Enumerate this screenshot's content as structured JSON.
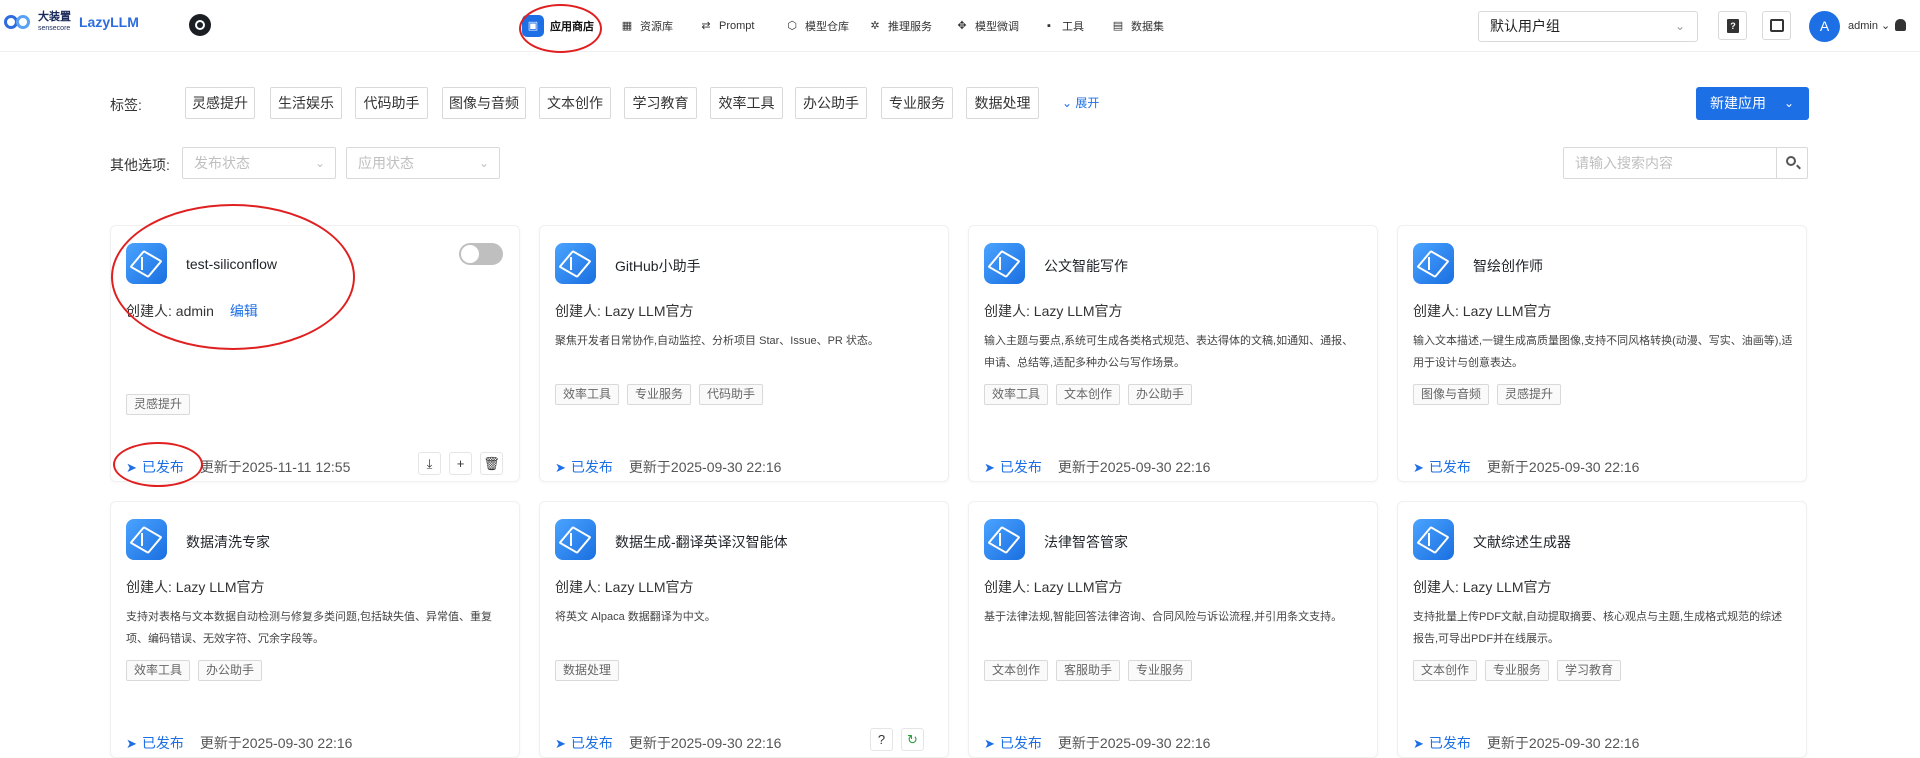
{
  "header": {
    "logo_cn": "大装置",
    "logo_en": "sensecore",
    "logo_name": "LazyLLM",
    "nav": [
      {
        "label": "应用商店",
        "icon": "store-icon",
        "glyph": "▣",
        "active": true
      },
      {
        "label": "资源库",
        "icon": "grid-icon",
        "glyph": "▦",
        "active": false
      },
      {
        "label": "Prompt",
        "icon": "prompt-icon",
        "glyph": "⇄",
        "active": false
      },
      {
        "label": "模型仓库",
        "icon": "model-icon",
        "glyph": "⬡",
        "active": false
      },
      {
        "label": "推理服务",
        "icon": "inference-icon",
        "glyph": "✲",
        "active": false
      },
      {
        "label": "模型微调",
        "icon": "finetune-icon",
        "glyph": "✥",
        "active": false
      },
      {
        "label": "工具",
        "icon": "tools-icon",
        "glyph": "▪",
        "active": false
      },
      {
        "label": "数据集",
        "icon": "dataset-icon",
        "glyph": "▤",
        "active": false
      }
    ],
    "user_group": "默认用户组",
    "avatar_letter": "A",
    "user_name": "admin"
  },
  "filters": {
    "tags_label": "标签:",
    "tags": [
      "灵感提升",
      "生活娱乐",
      "代码助手",
      "图像与音频",
      "文本创作",
      "学习教育",
      "效率工具",
      "办公助手",
      "专业服务",
      "数据处理"
    ],
    "expand_label": "展开",
    "new_app_label": "新建应用",
    "other_label": "其他选项:",
    "publish_status_placeholder": "发布状态",
    "app_status_placeholder": "应用状态",
    "search_placeholder": "请输入搜索内容"
  },
  "cards": [
    {
      "title": "test-siliconflow",
      "creator": "创建人: admin",
      "edit": "编辑",
      "desc": "",
      "tags": [
        "灵感提升"
      ],
      "status": "已发布",
      "updated": "更新于2025-11-11 12:55"
    },
    {
      "title": "GitHub小助手",
      "creator": "创建人: Lazy LLM官方",
      "desc": "聚焦开发者日常协作,自动监控、分析项目 Star、Issue、PR 状态。",
      "tags": [
        "效率工具",
        "专业服务",
        "代码助手"
      ],
      "status": "已发布",
      "updated": "更新于2025-09-30 22:16"
    },
    {
      "title": "公文智能写作",
      "creator": "创建人: Lazy LLM官方",
      "desc": "输入主题与要点,系统可生成各类格式规范、表达得体的文稿,如通知、通报、申请、总结等,适配多种办公与写作场景。",
      "tags": [
        "效率工具",
        "文本创作",
        "办公助手"
      ],
      "status": "已发布",
      "updated": "更新于2025-09-30 22:16"
    },
    {
      "title": "智绘创作师",
      "creator": "创建人: Lazy LLM官方",
      "desc": "输入文本描述,一键生成高质量图像,支持不同风格转换(动漫、写实、油画等),适用于设计与创意表达。",
      "tags": [
        "图像与音频",
        "灵感提升"
      ],
      "status": "已发布",
      "updated": "更新于2025-09-30 22:16"
    },
    {
      "title": "数据清洗专家",
      "creator": "创建人: Lazy LLM官方",
      "desc": "支持对表格与文本数据自动检测与修复多类问题,包括缺失值、异常值、重复项、编码错误、无效字符、冗余字段等。",
      "tags": [
        "效率工具",
        "办公助手"
      ],
      "status": "已发布",
      "updated": "更新于2025-09-30 22:16"
    },
    {
      "title": "数据生成-翻译英译汉智能体",
      "creator": "创建人: Lazy LLM官方",
      "desc": "将英文 Alpaca 数据翻译为中文。",
      "tags": [
        "数据处理"
      ],
      "status": "已发布",
      "updated": "更新于2025-09-30 22:16"
    },
    {
      "title": "法律智答管家",
      "creator": "创建人: Lazy LLM官方",
      "desc": "基于法律法规,智能回答法律咨询、合同风险与诉讼流程,并引用条文支持。",
      "tags": [
        "文本创作",
        "客服助手",
        "专业服务"
      ],
      "status": "已发布",
      "updated": "更新于2025-09-30 22:16"
    },
    {
      "title": "文献综述生成器",
      "creator": "创建人: Lazy LLM官方",
      "desc": "支持批量上传PDF文献,自动提取摘要、核心观点与主题,生成格式规范的综述报告,可导出PDF并在线展示。",
      "tags": [
        "文本创作",
        "专业服务",
        "学习教育"
      ],
      "status": "已发布",
      "updated": "更新于2025-09-30 22:16"
    }
  ],
  "colors": {
    "accent": "#1d6fe6",
    "annotation": "#e02020"
  }
}
